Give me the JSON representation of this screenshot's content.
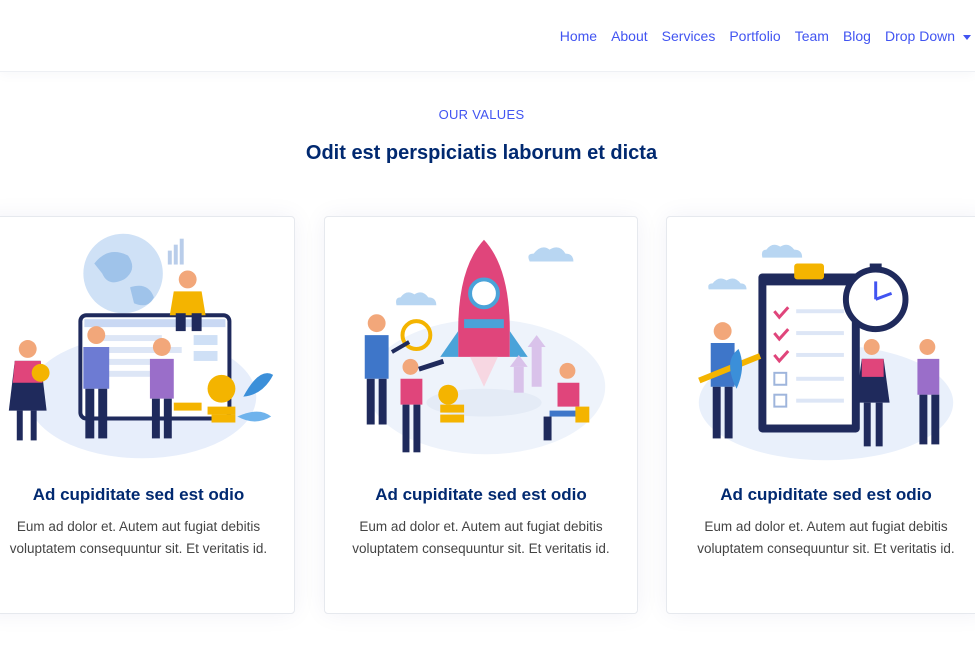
{
  "nav": {
    "items": [
      {
        "label": "Home",
        "name": "nav-home"
      },
      {
        "label": "About",
        "name": "nav-about"
      },
      {
        "label": "Services",
        "name": "nav-services"
      },
      {
        "label": "Portfolio",
        "name": "nav-portfolio"
      },
      {
        "label": "Team",
        "name": "nav-team"
      },
      {
        "label": "Blog",
        "name": "nav-blog"
      }
    ],
    "dropdown_label": "Drop Down"
  },
  "values": {
    "eyebrow": "OUR VALUES",
    "title": "Odit est perspiciatis laborum et dicta",
    "cards": [
      {
        "title": "Ad cupiditate sed est odio",
        "text": "Eum ad dolor et. Autem aut fugiat debitis voluptatem consequuntur sit. Et veritatis id.",
        "illustration": "team-dashboard-illustration"
      },
      {
        "title": "Ad cupiditate sed est odio",
        "text": "Eum ad dolor et. Autem aut fugiat debitis voluptatem consequuntur sit. Et veritatis id.",
        "illustration": "rocket-launch-illustration"
      },
      {
        "title": "Ad cupiditate sed est odio",
        "text": "Eum ad dolor et. Autem aut fugiat debitis voluptatem consequuntur sit. Et veritatis id.",
        "illustration": "checklist-stopwatch-illustration"
      }
    ]
  },
  "colors": {
    "brand_blue": "#4154f1",
    "heading_navy": "#012970",
    "accent_pink": "#e0457b",
    "accent_gold": "#f4b400"
  }
}
